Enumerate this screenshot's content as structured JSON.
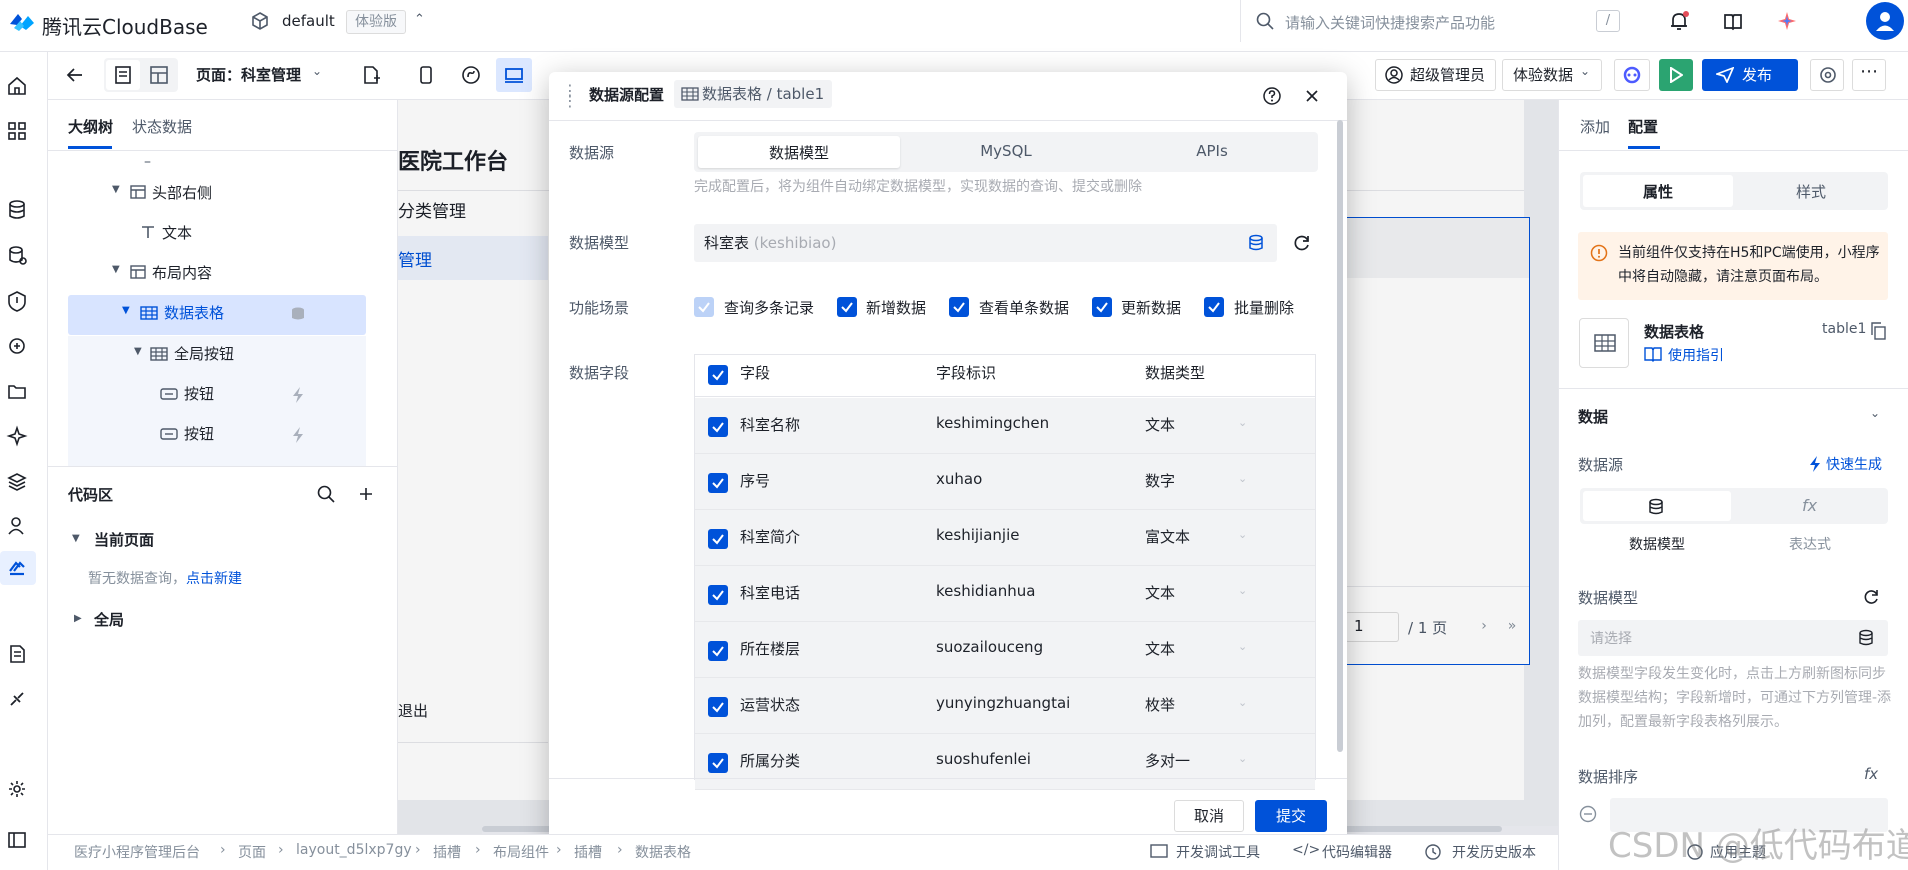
{
  "topbar": {
    "brand": "腾讯云CloudBase",
    "env_name": "default",
    "env_tag": "体验版",
    "search_placeholder": "请输入关键词快捷搜索产品功能",
    "search_shortcut": "/"
  },
  "toolbar": {
    "page_label": "页面：科室管理",
    "role": "超级管理员",
    "data_mode": "体验数据",
    "publish": "发布"
  },
  "left_panel": {
    "tabs": [
      "大纲树",
      "状态数据"
    ],
    "tree": [
      {
        "label": "头部右侧"
      },
      {
        "label": "文本"
      },
      {
        "label": "布局内容"
      },
      {
        "label": "数据表格"
      },
      {
        "label": "全局按钮"
      },
      {
        "label": "按钮"
      },
      {
        "label": "按钮"
      }
    ],
    "code_title": "代码区",
    "current_page": "当前页面",
    "no_query": "暂无数据查询，",
    "new_link": "点击新建",
    "global": "全局"
  },
  "canvas": {
    "title": "医院工作台",
    "menu1": "分类管理",
    "menu2": "管理",
    "exit": "退出",
    "page_num": "1",
    "page_total": "/ 1 页"
  },
  "modal": {
    "title": "数据源配置",
    "crumb": "数据表格 / table1",
    "label_source": "数据源",
    "source_tabs": [
      "数据模型",
      "MySQL",
      "APIs"
    ],
    "hint": "完成配置后，将为组件自动绑定数据模型，实现数据的查询、提交或删除",
    "label_model": "数据模型",
    "model_value": "科室表",
    "model_key": "(keshibiao)",
    "label_scene": "功能场景",
    "scenes": [
      "查询多条记录",
      "新增数据",
      "查看单条数据",
      "更新数据",
      "批量删除"
    ],
    "label_fields": "数据字段",
    "columns": [
      "字段",
      "字段标识",
      "数据类型"
    ],
    "rows": [
      {
        "name": "科室名称",
        "key": "keshimingchen",
        "type": "文本"
      },
      {
        "name": "序号",
        "key": "xuhao",
        "type": "数字"
      },
      {
        "name": "科室简介",
        "key": "keshijianjie",
        "type": "富文本"
      },
      {
        "name": "科室电话",
        "key": "keshidianhua",
        "type": "文本"
      },
      {
        "name": "所在楼层",
        "key": "suozailouceng",
        "type": "文本"
      },
      {
        "name": "运营状态",
        "key": "yunyingzhuangtai",
        "type": "枚举"
      },
      {
        "name": "所属分类",
        "key": "suoshufenlei",
        "type": "多对一"
      }
    ],
    "cancel": "取消",
    "submit": "提交"
  },
  "right_panel": {
    "tabs": [
      "添加",
      "配置"
    ],
    "seg": [
      "属性",
      "样式"
    ],
    "warning": "当前组件仅支持在H5和PC端使用，小程序中将自动隐藏，请注意页面布局。",
    "comp_name": "数据表格",
    "comp_id": "table1",
    "guide": "使用指引",
    "section_data": "数据",
    "data_source": "数据源",
    "quick_gen": "快速生成",
    "src_model": "数据模型",
    "src_expr": "表达式",
    "model_label": "数据模型",
    "select_ph": "请选择",
    "note": "数据模型字段发生变化时，点击上方刷新图标同步数据模型结构；字段新增时，可通过下方列管理-添加列，配置最新字段表格列展示。",
    "sort_label": "数据排序"
  },
  "status_bar": {
    "crumbs": [
      "医疗小程序管理后台",
      "页面",
      "layout_d5lxp7gy",
      "插槽",
      "布局组件",
      "插槽",
      "数据表格"
    ],
    "debug": "开发调试工具",
    "code_editor": "代码编辑器",
    "history": "开发历史版本",
    "theme": "应用主题"
  },
  "watermark": "CSDN @低代码布道师",
  "colors": {
    "primary": "#0052d9",
    "publish_green": "#2ba471",
    "warn_bg": "#fff3e8",
    "warn_icon": "#e37318"
  }
}
